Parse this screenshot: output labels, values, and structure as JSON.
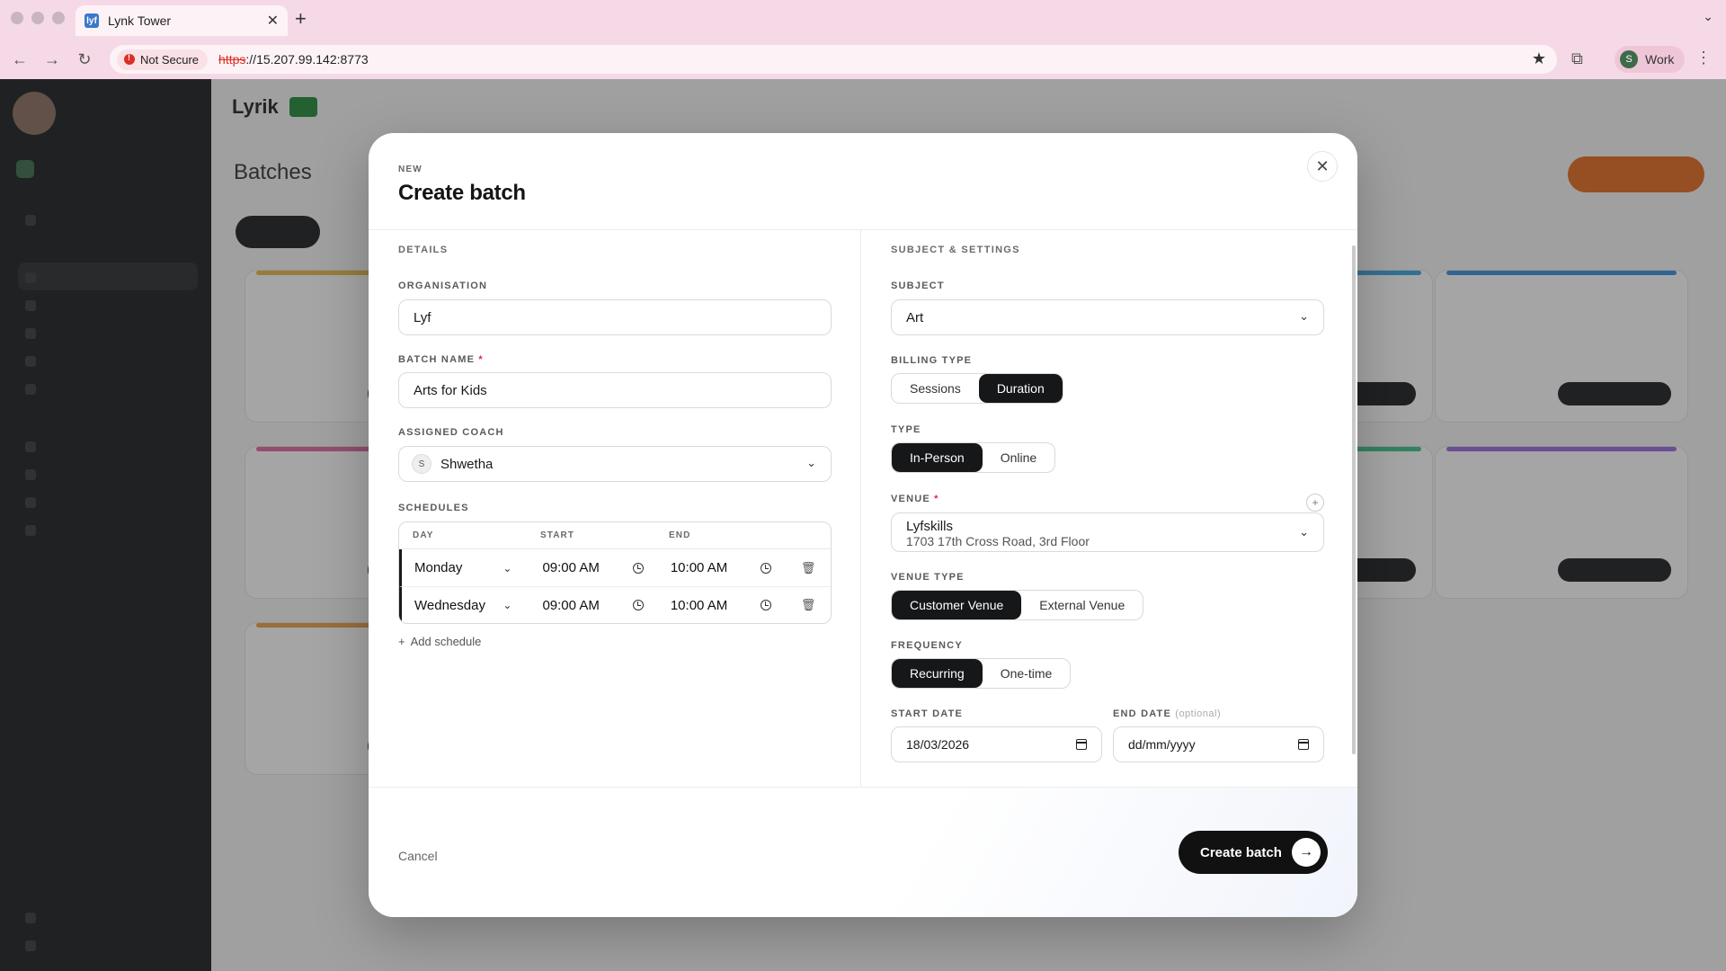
{
  "browser": {
    "tab_title": "Lynk Tower",
    "favicon_text": "lyf",
    "security_label": "Not Secure",
    "url_scheme": "https",
    "url_rest": "://15.207.99.142:8773",
    "profile_initial": "S",
    "profile_name": "Work"
  },
  "background": {
    "logo": "Lyrik",
    "page_title": "Batches"
  },
  "modal": {
    "eyebrow": "NEW",
    "title": "Create batch",
    "left_section": "DETAILS",
    "organisation_label": "ORGANISATION",
    "organisation_value": "Lyf",
    "batch_name_label": "BATCH NAME",
    "batch_name_value": "Arts for Kids",
    "coach_label": "ASSIGNED COACH",
    "coach_initial": "S",
    "coach_value": "Shwetha",
    "schedules_label": "SCHEDULES",
    "schedule_headers": {
      "day": "DAY",
      "start": "START",
      "end": "END"
    },
    "schedules": [
      {
        "day": "Monday",
        "start": "09:00 AM",
        "end": "10:00 AM"
      },
      {
        "day": "Wednesday",
        "start": "09:00 AM",
        "end": "10:00 AM"
      }
    ],
    "add_schedule": "Add schedule",
    "right_section": "SUBJECT & SETTINGS",
    "subject_label": "SUBJECT",
    "subject_value": "Art",
    "billing_label": "BILLING TYPE",
    "billing_options": [
      "Sessions",
      "Duration"
    ],
    "billing_selected": "Duration",
    "type_label": "TYPE",
    "type_options": [
      "In-Person",
      "Online"
    ],
    "type_selected": "In-Person",
    "venue_label": "VENUE",
    "venue_name": "Lyfskills",
    "venue_address": "1703 17th Cross Road, 3rd Floor",
    "venue_type_label": "VENUE TYPE",
    "venue_type_options": [
      "Customer Venue",
      "External Venue"
    ],
    "venue_type_selected": "Customer Venue",
    "frequency_label": "FREQUENCY",
    "frequency_options": [
      "Recurring",
      "One-time"
    ],
    "frequency_selected": "Recurring",
    "start_date_label": "START DATE",
    "start_date_value": "18/03/2026",
    "end_date_label": "END DATE",
    "end_date_optional": "(optional)",
    "end_date_placeholder": "dd/mm/yyyy",
    "cancel_label": "Cancel",
    "submit_label": "Create batch"
  }
}
